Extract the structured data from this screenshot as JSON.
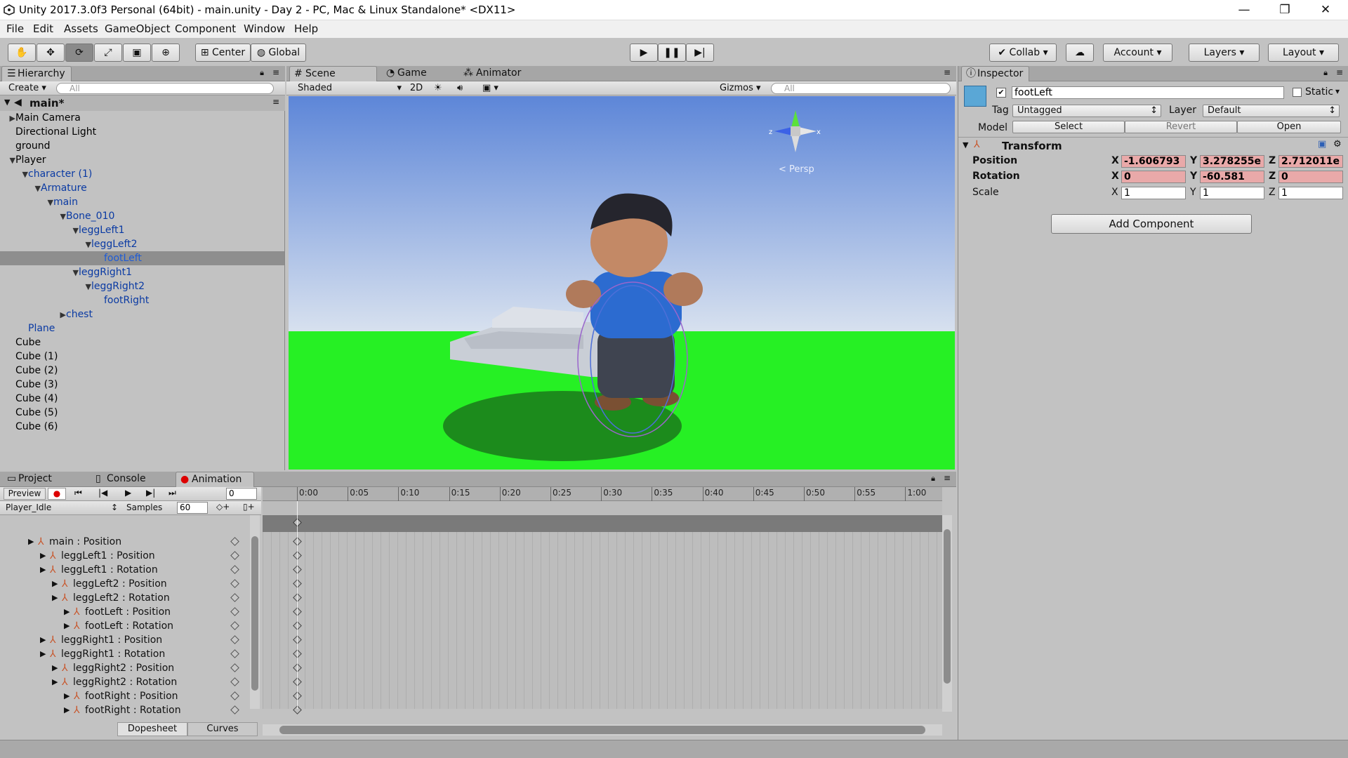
{
  "window": {
    "title": "Unity 2017.3.0f3 Personal (64bit) - main.unity - Day 2 - PC, Mac & Linux Standalone* <DX11>",
    "minimize": "—",
    "maximize": "❐",
    "close": "✕"
  },
  "menu": [
    "File",
    "Edit",
    "Assets",
    "GameObject",
    "Component",
    "Window",
    "Help"
  ],
  "toolbar": {
    "center": "Center",
    "global": "Global",
    "collab": "Collab",
    "account": "Account",
    "layers": "Layers",
    "layout": "Layout"
  },
  "hierarchy": {
    "tab": "Hierarchy",
    "create": "Create",
    "search_placeholder": "All",
    "scene": "main*",
    "rows": [
      {
        "label": "Main Camera",
        "arrow": "▶"
      },
      {
        "label": "Directional Light",
        "arrow": ""
      },
      {
        "label": "ground",
        "arrow": ""
      },
      {
        "label": "Player",
        "arrow": "▼"
      },
      {
        "label": "character (1)",
        "arrow": "▼",
        "blue": true
      },
      {
        "label": "Armature",
        "arrow": "▼",
        "blue": true
      },
      {
        "label": "main",
        "arrow": "▼",
        "blue": true
      },
      {
        "label": "Bone_010",
        "arrow": "▼",
        "blue": true
      },
      {
        "label": "leggLeft1",
        "arrow": "▼",
        "blue": true
      },
      {
        "label": "leggLeft2",
        "arrow": "▼",
        "blue": true
      },
      {
        "label": "footLeft",
        "arrow": "",
        "blue": true,
        "selected": true
      },
      {
        "label": "leggRight1",
        "arrow": "▼",
        "blue": true
      },
      {
        "label": "leggRight2",
        "arrow": "▼",
        "blue": true
      },
      {
        "label": "footRight",
        "arrow": "",
        "blue": true
      },
      {
        "label": "chest",
        "arrow": "▶",
        "blue": true
      },
      {
        "label": "Plane",
        "arrow": "",
        "blue": true
      },
      {
        "label": "Cube",
        "arrow": ""
      },
      {
        "label": "Cube (1)",
        "arrow": ""
      },
      {
        "label": "Cube (2)",
        "arrow": ""
      },
      {
        "label": "Cube (3)",
        "arrow": ""
      },
      {
        "label": "Cube (4)",
        "arrow": ""
      },
      {
        "label": "Cube (5)",
        "arrow": ""
      },
      {
        "label": "Cube (6)",
        "arrow": ""
      }
    ]
  },
  "scene": {
    "tabs": [
      "Scene",
      "Game",
      "Animator"
    ],
    "shaded": "Shaded",
    "mode2d": "2D",
    "gizmos": "Gizmos",
    "search_placeholder": "All",
    "persp": "< Persp",
    "axis_x": "x",
    "axis_z": "z"
  },
  "inspector": {
    "tab": "Inspector",
    "object_name": "footLeft",
    "static": "Static",
    "tag_label": "Tag",
    "tag": "Untagged",
    "layer_label": "Layer",
    "layer": "Default",
    "model_label": "Model",
    "select": "Select",
    "revert": "Revert",
    "open": "Open",
    "transform": "Transform",
    "position": {
      "label": "Position",
      "x": "-1.606793",
      "y": "3.278255e",
      "z": "2.712011e"
    },
    "rotation": {
      "label": "Rotation",
      "x": "0",
      "y": "-60.581",
      "z": "0"
    },
    "scale": {
      "label": "Scale",
      "x": "1",
      "y": "1",
      "z": "1"
    },
    "add_component": "Add Component",
    "axis_x": "X",
    "axis_y": "Y",
    "axis_z": "Z"
  },
  "bottom": {
    "tabs": [
      "Project",
      "Console",
      "Animation"
    ],
    "preview": "Preview",
    "frame": "0",
    "clip": "Player_Idle",
    "samples_label": "Samples",
    "samples": "60",
    "timeline": [
      "0:00",
      "0:05",
      "0:10",
      "0:15",
      "0:20",
      "0:25",
      "0:30",
      "0:35",
      "0:40",
      "0:45",
      "0:50",
      "0:55",
      "1:00"
    ],
    "properties": [
      {
        "label": "main : Position",
        "indent": 0
      },
      {
        "label": "leggLeft1 : Position",
        "indent": 1
      },
      {
        "label": "leggLeft1 : Rotation",
        "indent": 1
      },
      {
        "label": "leggLeft2 : Position",
        "indent": 2
      },
      {
        "label": "leggLeft2 : Rotation",
        "indent": 2
      },
      {
        "label": "footLeft : Position",
        "indent": 3
      },
      {
        "label": "footLeft : Rotation",
        "indent": 3
      },
      {
        "label": "leggRight1 : Position",
        "indent": 1
      },
      {
        "label": "leggRight1 : Rotation",
        "indent": 1
      },
      {
        "label": "leggRight2 : Position",
        "indent": 2
      },
      {
        "label": "leggRight2 : Rotation",
        "indent": 2
      },
      {
        "label": "footRight : Position",
        "indent": 3
      },
      {
        "label": "footRight : Rotation",
        "indent": 3
      }
    ],
    "dopesheet": "Dopesheet",
    "curves": "Curves"
  }
}
